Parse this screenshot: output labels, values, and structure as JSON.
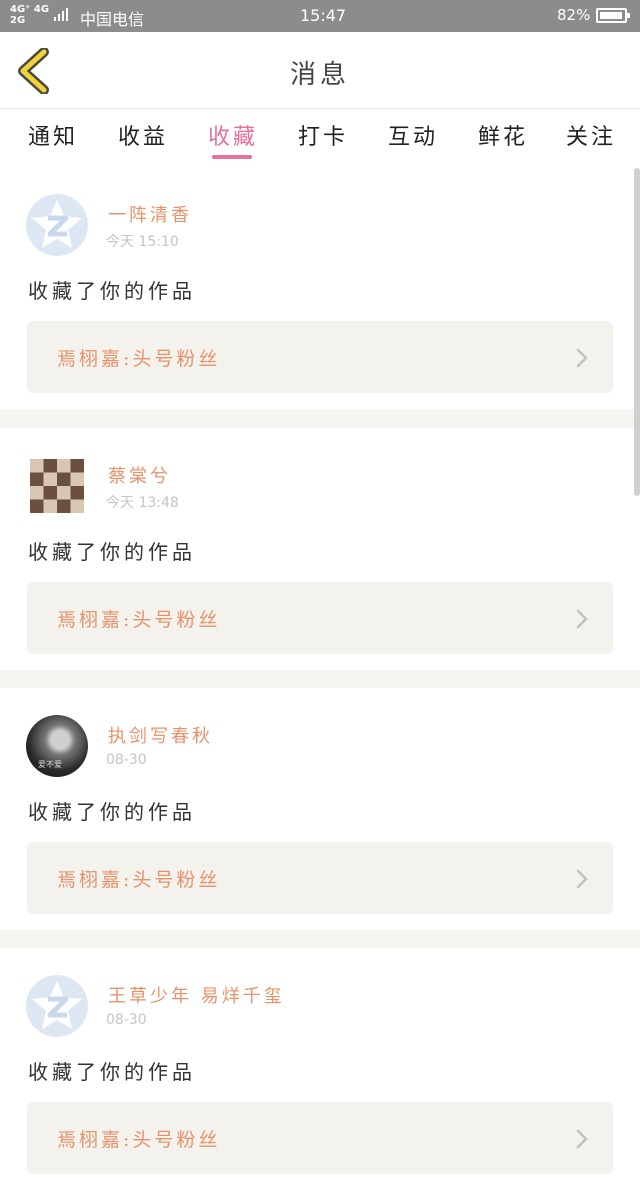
{
  "status_bar": {
    "network": "4G⁺ 4G\n2G",
    "carrier": "中国电信",
    "time": "15:47",
    "battery": "82%"
  },
  "header": {
    "title": "消息"
  },
  "tabs": [
    {
      "label": "通知",
      "active": false
    },
    {
      "label": "收益",
      "active": false
    },
    {
      "label": "收藏",
      "active": true
    },
    {
      "label": "打卡",
      "active": false
    },
    {
      "label": "互动",
      "active": false
    },
    {
      "label": "鲜花",
      "active": false
    },
    {
      "label": "关注",
      "active": false
    }
  ],
  "messages": [
    {
      "user": "一阵清香",
      "time": "今天 15:10",
      "action": "收藏了你的作品",
      "work": "焉栩嘉:头号粉丝",
      "avatar": "default-avatar-icon"
    },
    {
      "user": "蔡棠兮",
      "time": "今天 13:48",
      "action": "收藏了你的作品",
      "work": "焉栩嘉:头号粉丝",
      "avatar": "photo-grid"
    },
    {
      "user": "执剑写春秋",
      "time": "08-30",
      "action": "收藏了你的作品",
      "work": "焉栩嘉:头号粉丝",
      "avatar": "dark-photo",
      "avatar_overlay": "爱不爱"
    },
    {
      "user": "王草少年 易烊千玺",
      "time": "08-30",
      "action": "收藏了你的作品",
      "work": "焉栩嘉:头号粉丝",
      "avatar": "default-avatar-icon"
    }
  ],
  "colors": {
    "accent": "#e8709c",
    "username": "#e8926b",
    "link_bg": "#f3f2ec",
    "back_icon": "#f2d23a"
  }
}
